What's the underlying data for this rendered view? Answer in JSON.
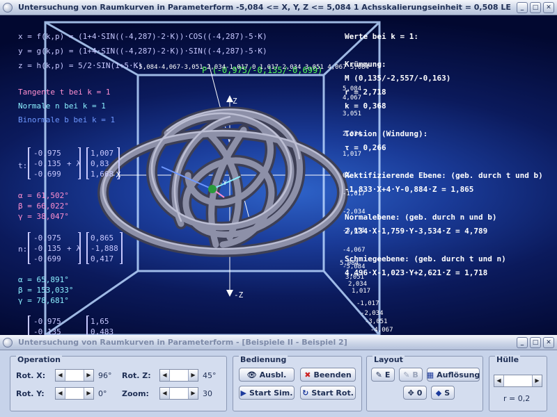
{
  "window_top": {
    "title": "Untersuchung von Raumkurven in Parameterform    -5,084 <= X, Y, Z <= 5,084    1 Achsskalierungseinheit = 0,508 LE"
  },
  "window_bottom": {
    "title": "Untersuchung von Raumkurven in Parameterform - [Beispiele II - Beispiel 2]"
  },
  "formulas": {
    "x": "x = f(k,p) = (1+4·SIN((-4,287)-2·K))·COS((-4,287)-5·K)",
    "y": "y = g(k,p) = (1+4·SIN((-4,287)-2·K))·SIN((-4,287)-5·K)",
    "z": "z = h(k,p) = 5/2·SIN(1+5·K)"
  },
  "legend": {
    "tangent": "Tangente t bei k = 1",
    "normal": "Normale n bei k = 1",
    "binormal": "Binormale b bei k = 1"
  },
  "tangent": {
    "prefix": "t:",
    "v1": [
      "-0,975",
      "-0,135",
      "-0,699"
    ],
    "op": "+ λ",
    "v2": [
      "1,007",
      "0,83",
      "1,668"
    ],
    "angles": [
      "α = 61,502°",
      "β = 66,022°",
      "γ = 38,047°"
    ]
  },
  "normal": {
    "prefix": "n:",
    "v1": [
      "-0,975",
      "-0,135",
      "-0,699"
    ],
    "op": "+ λ",
    "v2": [
      "0,865",
      "-1,888",
      "0,417"
    ],
    "angles": [
      "α = 65,891°",
      "β = 153,033°",
      "γ = 78,681°"
    ]
  },
  "binormal_partial": {
    "v1": [
      "-0,975",
      "-0,135"
    ],
    "v2": [
      "1,65",
      "0,483"
    ]
  },
  "results": {
    "title": "Werte bei k = 1:",
    "curvature_title": "Krümmung:",
    "m": "M (0,135/-2,557/-0,163)",
    "r": "r = 2,718",
    "k": "k = 0,368",
    "torsion_title": "Torsion (Windung):",
    "tau": "τ = 0,266",
    "rect_title": "Rektifizierende Ebene: (geb. durch t und b)",
    "rect_eq": "-1,833·X+4·Y-0,884·Z = 1,865",
    "normal_title": "Normalebene: (geb. durch n und b)",
    "normal_eq": "2,134·X-1,759·Y-3,534·Z = 4,789",
    "osc_title": "Schmiegeebene: (geb. durch t und n)",
    "osc_eq": "4,496·X-1,023·Y+2,621·Z = 1,718"
  },
  "point_label": "P (-0,975/-0,135/-0,699)",
  "axes": {
    "z_top": "Z",
    "z_bottom": "-Z",
    "x_left": "-X",
    "x_right": "X",
    "y_neg": "-Y",
    "top_ticks": "-5,084-4,067-3,051-2,034-1,017 0  1,017 2,034 3,051 4,067 5,084",
    "right_ticks": [
      "5,084",
      "4,067",
      "3,051",
      "2,034",
      "1,017",
      "0",
      "-1,017",
      "-2,034",
      "-3,051",
      "-4,067",
      "-5,084"
    ],
    "bottom_ticks": [
      "5,084",
      "3,051",
      "2,034",
      "1,017",
      "-1,017",
      "-2,034",
      "-3,051",
      "-4,067"
    ]
  },
  "controls": {
    "operation": {
      "label": "Operation",
      "rot_x_label": "Rot. X:",
      "rot_x_value": "96°",
      "rot_y_label": "Rot. Y:",
      "rot_y_value": "0°",
      "rot_z_label": "Rot. Z:",
      "rot_z_value": "45°",
      "zoom_label": "Zoom:",
      "zoom_value": "30"
    },
    "bedienung": {
      "label": "Bedienung",
      "ausbl": "Ausbl.",
      "beenden": "Beenden",
      "start_sim": "Start Sim.",
      "start_rot": "Start Rot."
    },
    "layout": {
      "label": "Layout",
      "e": "E",
      "b": "B",
      "aufloesung": "Auflösung",
      "zero": "0",
      "s": "S"
    },
    "huelle": {
      "label": "Hülle",
      "r": "r = 0,2"
    }
  },
  "colors": {
    "accent_tangent": "#ff8fd0",
    "accent_normal": "#8cf0ff",
    "accent_binormal": "#6f98ff"
  }
}
